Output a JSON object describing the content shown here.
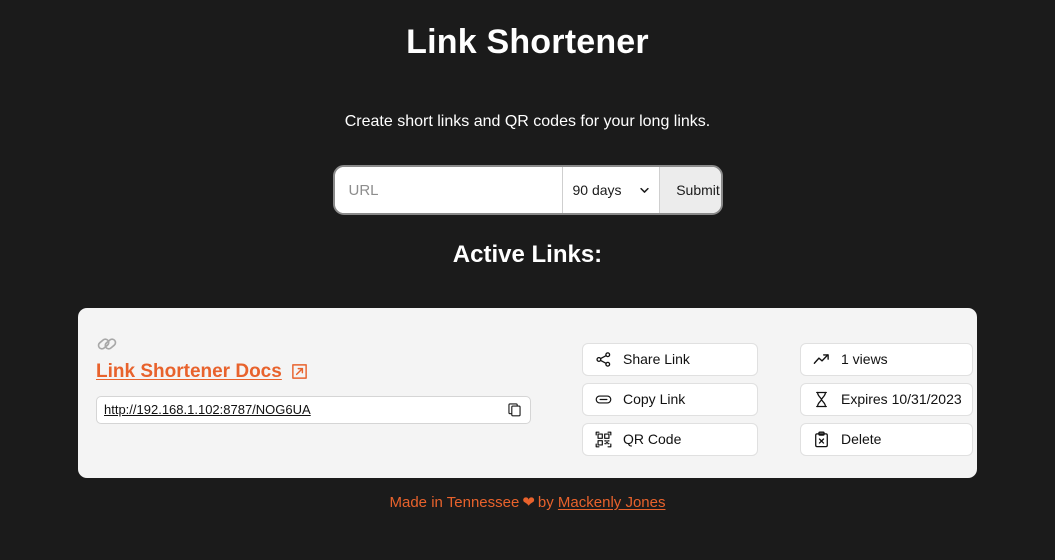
{
  "header": {
    "title": "Link Shortener",
    "subtitle": "Create short links and QR codes for your long links."
  },
  "form": {
    "url_placeholder": "URL",
    "url_value": "",
    "expiry_selected": "90 days",
    "expiry_options": [
      "90 days"
    ],
    "submit_label": "Submit",
    "chevron_icon": "chevron-down-icon"
  },
  "links_section": {
    "heading": "Active Links:"
  },
  "link_card": {
    "link_icon": "chain-link-icon",
    "title": "Link Shortener Docs",
    "external_icon": "external-link-icon",
    "short_url": "http://192.168.1.102:8787/NOG6UA",
    "copy_icon": "copy-icon",
    "actions": [
      {
        "label": "Share Link",
        "icon": "share-icon"
      },
      {
        "label": "Copy Link",
        "icon": "link-icon"
      },
      {
        "label": "QR Code",
        "icon": "qr-code-icon"
      }
    ],
    "stats": [
      {
        "label": "1 views",
        "icon": "trending-up-icon"
      },
      {
        "label": "Expires 10/31/2023",
        "icon": "hourglass-icon"
      },
      {
        "label": "Delete",
        "icon": "clipboard-x-icon"
      }
    ]
  },
  "footer": {
    "prefix": "Made in Tennessee",
    "heart": "❤",
    "by": "by",
    "author": "Mackenly Jones"
  },
  "colors": {
    "background": "#1b1b1b",
    "card": "#f4f4f4",
    "accent": "#e8622c",
    "button": "#ffffff"
  }
}
